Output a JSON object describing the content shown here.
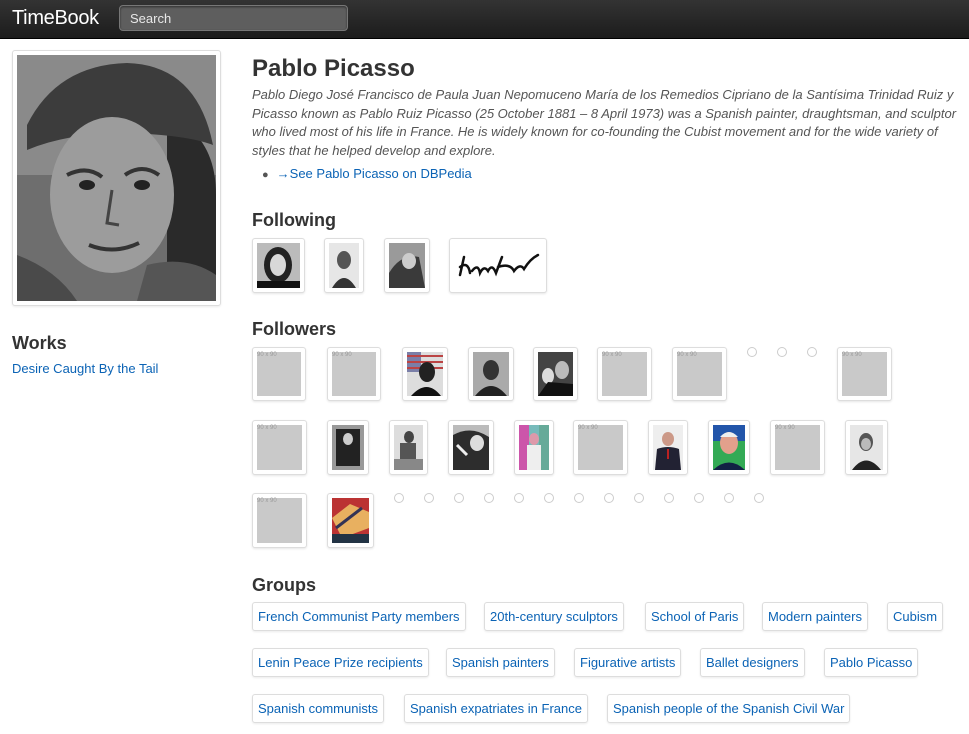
{
  "app": {
    "brand": "TimeBook",
    "search_placeholder": "Search"
  },
  "person": {
    "name": "Pablo Picasso",
    "bio": "Pablo Diego José Francisco de Paula Juan Nepomuceno María de los Remedios Cipriano de la Santísima Trinidad Ruiz y Picasso known as Pablo Ruiz Picasso (25 October 1881 – 8 April 1973) was a Spanish painter, draughtsman, and sculptor who lived most of his life in France. He is widely known for co-founding the Cubist movement and for the wide variety of styles that he helped develop and explore.",
    "dbpedia_link": "→See Pablo Picasso on DBPedia"
  },
  "works": {
    "title": "Works",
    "items": [
      "Desire Caught By the Tail"
    ]
  },
  "following": {
    "title": "Following"
  },
  "followers": {
    "title": "Followers",
    "placeholder_label": "90 x 90"
  },
  "groups": {
    "title": "Groups",
    "items": [
      "French Communist Party members",
      "20th-century sculptors",
      "School of Paris",
      "Modern painters",
      "Cubism",
      "Lenin Peace Prize recipients",
      "Spanish painters",
      "Figurative artists",
      "Ballet designers",
      "Pablo Picasso",
      "Spanish communists",
      "Spanish expatriates in France",
      "Spanish people of the Spanish Civil War"
    ]
  }
}
